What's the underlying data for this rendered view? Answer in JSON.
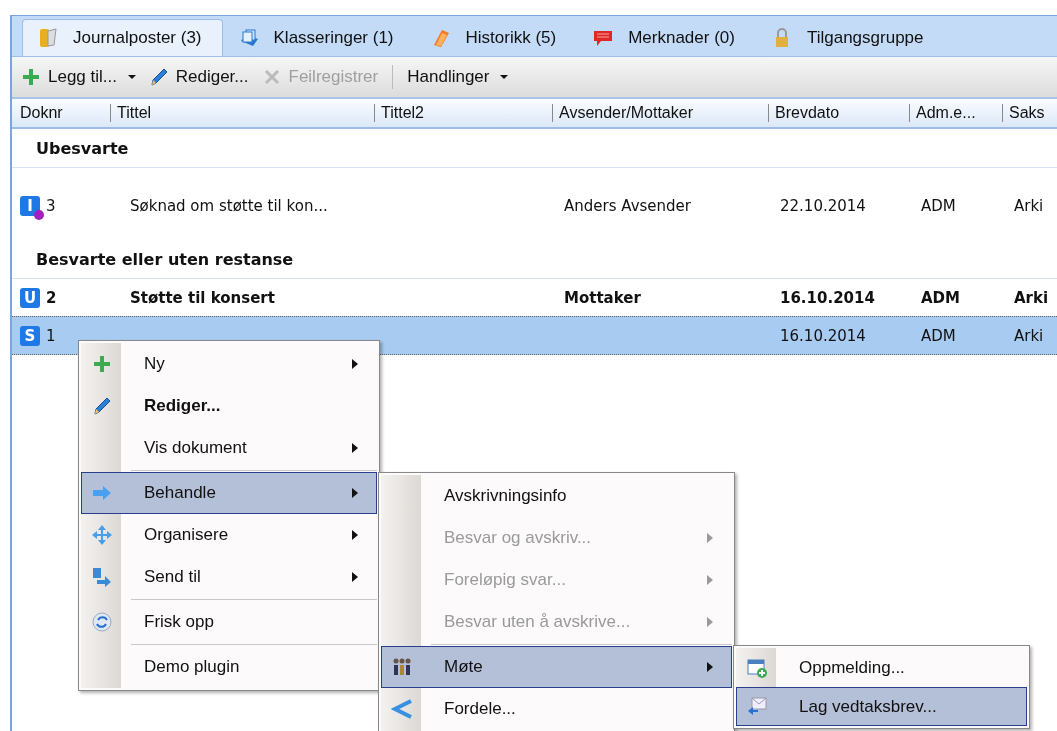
{
  "tabs": [
    {
      "label": "Journalposter (3)",
      "selected": true
    },
    {
      "label": "Klasseringer (1)",
      "selected": false
    },
    {
      "label": "Historikk (5)",
      "selected": false
    },
    {
      "label": "Merknader (0)",
      "selected": false
    },
    {
      "label": "Tilgangsgruppe",
      "selected": false
    }
  ],
  "toolbar": [
    {
      "kind": "button",
      "label": "Legg til...",
      "dropdown": true,
      "disabled": false
    },
    {
      "kind": "button",
      "label": "Rediger...",
      "dropdown": false,
      "disabled": false
    },
    {
      "kind": "button",
      "label": "Feilregistrer",
      "dropdown": false,
      "disabled": true
    },
    {
      "kind": "separator"
    },
    {
      "kind": "button",
      "label": "Handlinger",
      "dropdown": true,
      "disabled": false
    }
  ],
  "table": {
    "columns": [
      "Doknr",
      "Tittel",
      "Tittel2",
      "Avsender/Mottaker",
      "Brevdato",
      "Adm.e...",
      "Saks"
    ],
    "rows": [
      {
        "kind": "group",
        "label": "Ubesvarte"
      },
      {
        "kind": "record",
        "badge": "I",
        "flagged": true,
        "unread": false,
        "selected": false,
        "cells": [
          "3",
          "Søknad om støtte til kon...",
          "",
          "Anders Avsender",
          "22.10.2014",
          "ADM",
          "Arki"
        ]
      },
      {
        "kind": "group",
        "label": "Besvarte eller uten restanse"
      },
      {
        "kind": "record",
        "badge": "U",
        "flagged": false,
        "unread": true,
        "selected": false,
        "cells": [
          "2",
          "Støtte til konsert",
          "",
          "Mottaker",
          "16.10.2014",
          "ADM",
          "Arki"
        ]
      },
      {
        "kind": "record",
        "badge": "S",
        "flagged": false,
        "unread": false,
        "selected": true,
        "cells": [
          "1",
          "",
          "",
          "",
          "16.10.2014",
          "ADM",
          "Arki"
        ]
      }
    ]
  },
  "context_menu": {
    "items": [
      {
        "kind": "item",
        "label": "Ny",
        "submenu": true,
        "default": false,
        "disabled": false,
        "selected": false
      },
      {
        "kind": "item",
        "label": "Rediger...",
        "submenu": false,
        "default": true,
        "disabled": false,
        "selected": false
      },
      {
        "kind": "item",
        "label": "Vis dokument",
        "submenu": true,
        "default": false,
        "disabled": false,
        "selected": false
      },
      {
        "kind": "separator"
      },
      {
        "kind": "item",
        "label": "Behandle",
        "submenu": true,
        "default": false,
        "disabled": false,
        "selected": true
      },
      {
        "kind": "item",
        "label": "Organisere",
        "submenu": true,
        "default": false,
        "disabled": false,
        "selected": false
      },
      {
        "kind": "item",
        "label": "Send til",
        "submenu": true,
        "default": false,
        "disabled": false,
        "selected": false
      },
      {
        "kind": "separator"
      },
      {
        "kind": "item",
        "label": "Frisk opp",
        "submenu": false,
        "default": false,
        "disabled": false,
        "selected": false
      },
      {
        "kind": "separator"
      },
      {
        "kind": "item",
        "label": "Demo plugin",
        "submenu": false,
        "default": false,
        "disabled": false,
        "selected": false
      }
    ]
  },
  "submenu": {
    "items": [
      {
        "kind": "item",
        "label": "Avskrivningsinfo",
        "submenu": false,
        "default": false,
        "disabled": false,
        "selected": false
      },
      {
        "kind": "item",
        "label": "Besvar og avskriv...",
        "submenu": true,
        "default": false,
        "disabled": true,
        "selected": false
      },
      {
        "kind": "item",
        "label": "Foreløpig svar...",
        "submenu": true,
        "default": false,
        "disabled": true,
        "selected": false
      },
      {
        "kind": "item",
        "label": "Besvar uten å avskrive...",
        "submenu": true,
        "default": false,
        "disabled": true,
        "selected": false
      },
      {
        "kind": "separator"
      },
      {
        "kind": "item",
        "label": "Møte",
        "submenu": true,
        "default": false,
        "disabled": false,
        "selected": true
      },
      {
        "kind": "item",
        "label": "Fordele...",
        "submenu": false,
        "default": false,
        "disabled": false,
        "selected": false
      }
    ]
  },
  "submenu_2": {
    "items": [
      {
        "kind": "item",
        "label": "Oppmelding...",
        "submenu": false,
        "default": false,
        "disabled": false,
        "selected": false
      },
      {
        "kind": "item",
        "label": "Lag vedtaksbrev...",
        "submenu": false,
        "default": false,
        "disabled": false,
        "selected": true
      }
    ]
  }
}
